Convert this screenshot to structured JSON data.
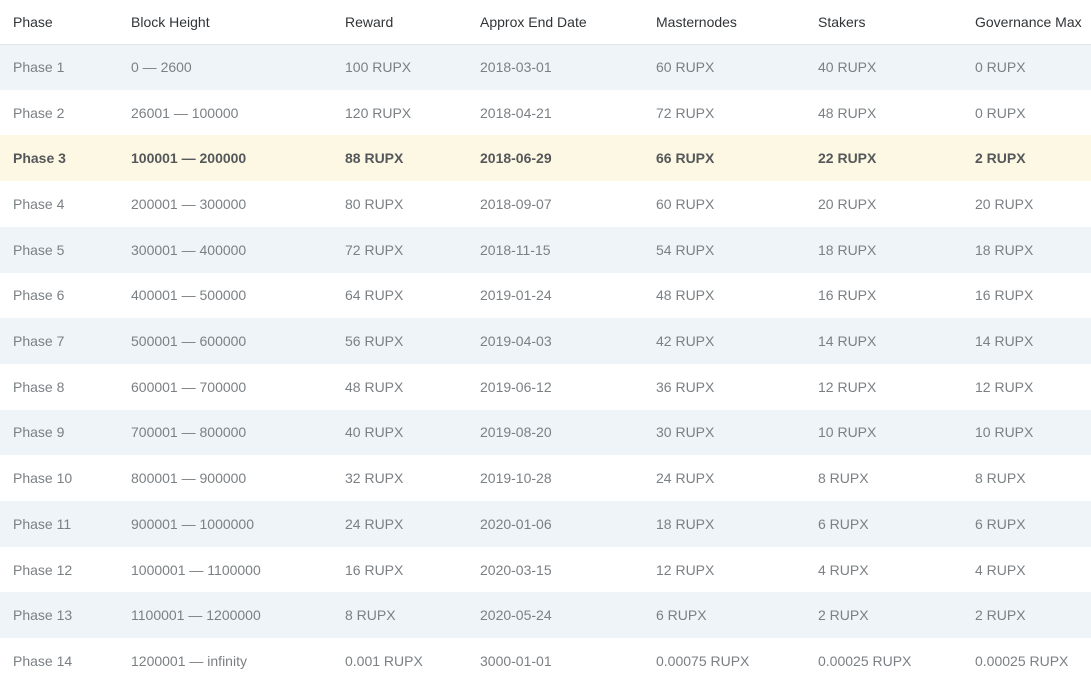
{
  "colors": {
    "stripe_bg": "#eff4f9",
    "highlight_bg": "#fdf8e3",
    "header_border": "#e2e2e2",
    "header_text": "#303437",
    "cell_text": "#7b8084",
    "highlight_text": "#55585a",
    "page_bg": "#ffffff"
  },
  "table": {
    "columns": [
      "Phase",
      "Block Height",
      "Reward",
      "Approx End Date",
      "Masternodes",
      "Stakers",
      "Governance Max"
    ],
    "rows": [
      {
        "highlighted": false,
        "cells": [
          "Phase 1",
          "0 — 2600",
          "100 RUPX",
          "2018-03-01",
          "60 RUPX",
          "40 RUPX",
          "0 RUPX"
        ]
      },
      {
        "highlighted": false,
        "cells": [
          "Phase 2",
          "26001 — 100000",
          "120 RUPX",
          "2018-04-21",
          "72 RUPX",
          "48 RUPX",
          "0 RUPX"
        ]
      },
      {
        "highlighted": true,
        "cells": [
          "Phase 3",
          "100001 — 200000",
          "88 RUPX",
          "2018-06-29",
          "66 RUPX",
          "22 RUPX",
          "2 RUPX"
        ]
      },
      {
        "highlighted": false,
        "cells": [
          "Phase 4",
          "200001 — 300000",
          "80 RUPX",
          "2018-09-07",
          "60 RUPX",
          "20 RUPX",
          "20 RUPX"
        ]
      },
      {
        "highlighted": false,
        "cells": [
          "Phase 5",
          "300001 — 400000",
          "72 RUPX",
          "2018-11-15",
          "54 RUPX",
          "18 RUPX",
          "18 RUPX"
        ]
      },
      {
        "highlighted": false,
        "cells": [
          "Phase 6",
          "400001 — 500000",
          "64 RUPX",
          "2019-01-24",
          "48 RUPX",
          "16 RUPX",
          "16 RUPX"
        ]
      },
      {
        "highlighted": false,
        "cells": [
          "Phase 7",
          "500001 — 600000",
          "56 RUPX",
          "2019-04-03",
          "42 RUPX",
          "14 RUPX",
          "14 RUPX"
        ]
      },
      {
        "highlighted": false,
        "cells": [
          "Phase 8",
          "600001 — 700000",
          "48 RUPX",
          "2019-06-12",
          "36 RUPX",
          "12 RUPX",
          "12 RUPX"
        ]
      },
      {
        "highlighted": false,
        "cells": [
          "Phase 9",
          "700001 — 800000",
          "40 RUPX",
          "2019-08-20",
          "30 RUPX",
          "10 RUPX",
          "10 RUPX"
        ]
      },
      {
        "highlighted": false,
        "cells": [
          "Phase 10",
          "800001 — 900000",
          "32 RUPX",
          "2019-10-28",
          "24 RUPX",
          "8 RUPX",
          "8 RUPX"
        ]
      },
      {
        "highlighted": false,
        "cells": [
          "Phase 11",
          "900001 — 1000000",
          "24 RUPX",
          "2020-01-06",
          "18 RUPX",
          "6 RUPX",
          "6 RUPX"
        ]
      },
      {
        "highlighted": false,
        "cells": [
          "Phase 12",
          "1000001 — 1100000",
          "16 RUPX",
          "2020-03-15",
          "12 RUPX",
          "4 RUPX",
          "4 RUPX"
        ]
      },
      {
        "highlighted": false,
        "cells": [
          "Phase 13",
          "1100001 — 1200000",
          "8 RUPX",
          "2020-05-24",
          "6 RUPX",
          "2 RUPX",
          "2 RUPX"
        ]
      },
      {
        "highlighted": false,
        "cells": [
          "Phase 14",
          "1200001 — infinity",
          "0.001 RUPX",
          "3000-01-01",
          "0.00075 RUPX",
          "0.00025 RUPX",
          "0.00025 RUPX"
        ]
      }
    ]
  }
}
